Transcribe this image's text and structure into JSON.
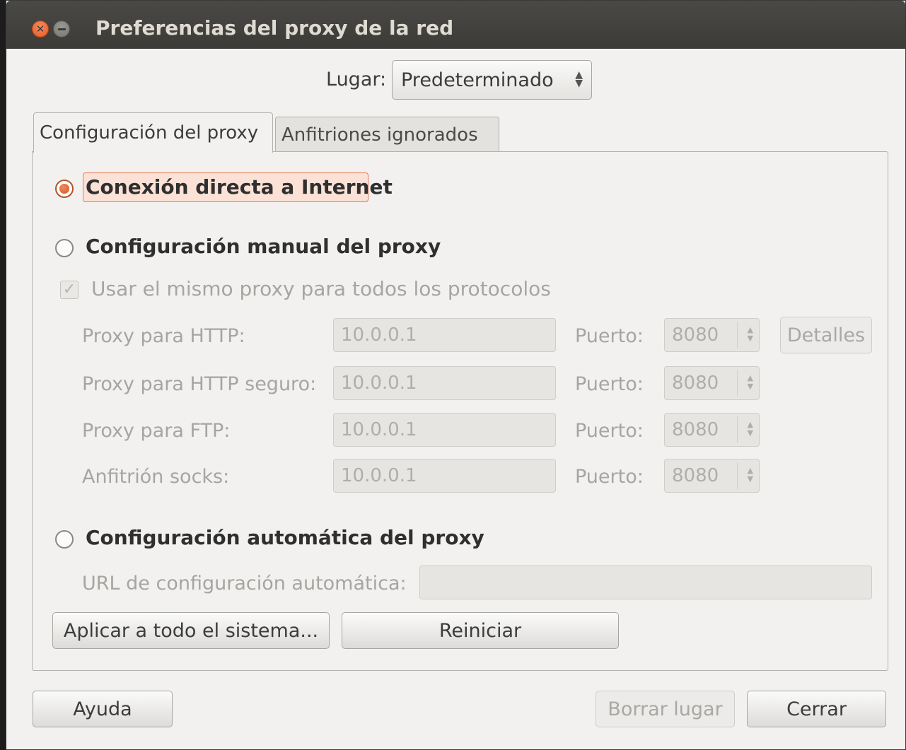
{
  "window": {
    "title": "Preferencias del proxy de la red"
  },
  "location": {
    "label": "Lugar:",
    "value": "Predeterminado"
  },
  "tabs": [
    {
      "label": "Configuración del proxy",
      "active": true
    },
    {
      "label": "Anfitriones ignorados",
      "active": false
    }
  ],
  "modes": {
    "direct": {
      "label": "Conexión directa a Internet",
      "selected": true
    },
    "manual": {
      "label": "Configuración manual del proxy",
      "selected": false
    },
    "auto": {
      "label": "Configuración automática del proxy",
      "selected": false
    }
  },
  "same_proxy": {
    "label": "Usar el mismo proxy para todos los protocolos",
    "checked": true,
    "enabled": false
  },
  "proxies": [
    {
      "label": "Proxy para HTTP:",
      "host": "10.0.0.1",
      "port_label": "Puerto:",
      "port": "8080"
    },
    {
      "label": "Proxy para HTTP seguro:",
      "host": "10.0.0.1",
      "port_label": "Puerto:",
      "port": "8080"
    },
    {
      "label": "Proxy para FTP:",
      "host": "10.0.0.1",
      "port_label": "Puerto:",
      "port": "8080"
    },
    {
      "label": "Anfitrión socks:",
      "host": "10.0.0.1",
      "port_label": "Puerto:",
      "port": "8080"
    }
  ],
  "details_button": "Detalles",
  "autoconfig": {
    "label": "URL de configuración automática:",
    "value": ""
  },
  "actions": {
    "apply_system": "Aplicar a todo el sistema...",
    "reset": "Reiniciar"
  },
  "footer": {
    "help": "Ayuda",
    "delete_location": "Borrar lugar",
    "close": "Cerrar"
  },
  "colors": {
    "titlebar": "#3c3b37",
    "accent": "#e35b2a",
    "window_bg": "#f2f1f0"
  }
}
